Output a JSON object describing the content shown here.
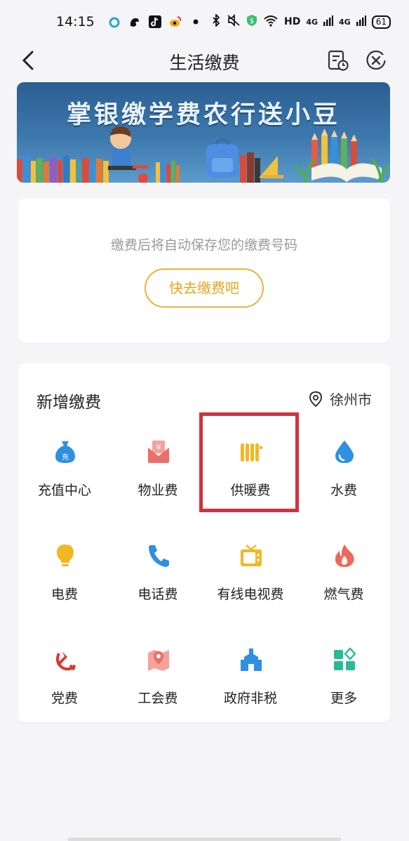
{
  "status_bar": {
    "time": "14:15",
    "network": "HD",
    "signal1": "4G",
    "signal2": "4G",
    "battery": "61"
  },
  "nav": {
    "title": "生活缴费",
    "back_icon": "chevron-left-icon",
    "bill_icon": "bill-clock-icon",
    "close_icon": "close-circle-icon"
  },
  "banner": {
    "text": "掌银缴学费农行送小豆"
  },
  "saved": {
    "hint": "缴费后将自动保存您的缴费号码",
    "button": "快去缴费吧"
  },
  "add_payment": {
    "title": "新增缴费",
    "city": "徐州市",
    "items": [
      {
        "label": "充值中心",
        "icon": "money-bag-icon",
        "color": "#2f8fe0"
      },
      {
        "label": "物业费",
        "icon": "property-envelope-icon",
        "color": "#e8706a"
      },
      {
        "label": "供暖费",
        "icon": "radiator-icon",
        "color": "#f2b724"
      },
      {
        "label": "水费",
        "icon": "water-drop-icon",
        "color": "#2f8fe0"
      },
      {
        "label": "电费",
        "icon": "light-bulb-icon",
        "color": "#f2b724"
      },
      {
        "label": "电话费",
        "icon": "phone-icon",
        "color": "#2f8fe0"
      },
      {
        "label": "有线电视费",
        "icon": "tv-icon",
        "color": "#f2b724"
      },
      {
        "label": "燃气费",
        "icon": "flame-icon",
        "color": "#f0665a"
      },
      {
        "label": "党费",
        "icon": "hammer-sickle-icon",
        "color": "#d83a2a"
      },
      {
        "label": "工会费",
        "icon": "map-pin-icon",
        "color": "#e8706a"
      },
      {
        "label": "政府非税",
        "icon": "government-building-icon",
        "color": "#2f8fe0"
      },
      {
        "label": "更多",
        "icon": "more-grid-icon",
        "color": "#2bb89a"
      }
    ]
  }
}
